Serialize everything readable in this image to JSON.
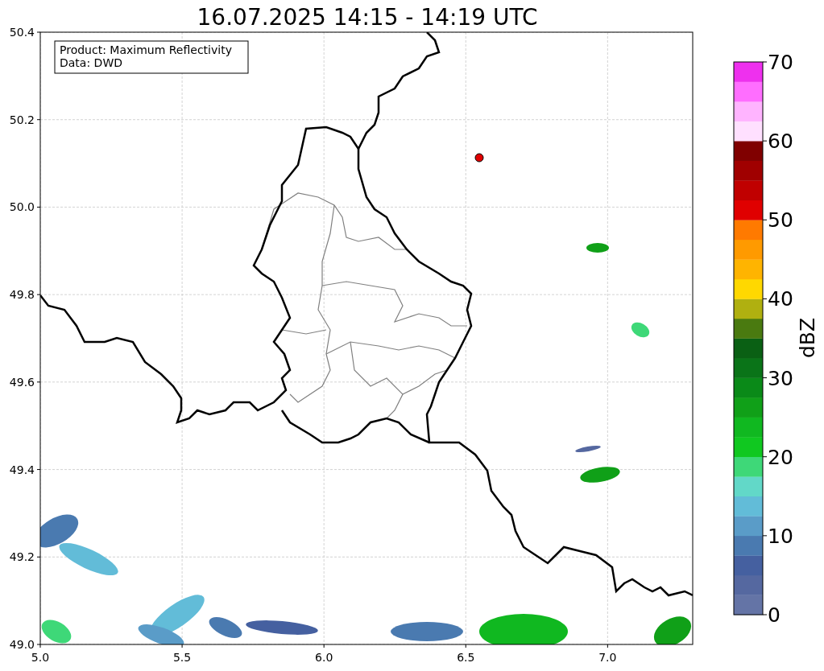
{
  "title": "16.07.2025 14:15 - 14:19 UTC",
  "annotation": [
    "Product: Maximum Reflectivity",
    "Data: DWD"
  ],
  "x_ticks": [
    "5.0",
    "5.5",
    "6.0",
    "6.5",
    "7.0"
  ],
  "y_ticks": [
    "50.4",
    "50.2",
    "50.0",
    "49.8",
    "49.6",
    "49.4",
    "49.2",
    "49.0"
  ],
  "colorbar": {
    "label": "dBZ",
    "ticks": [
      "70",
      "60",
      "50",
      "40",
      "30",
      "20",
      "10",
      "0"
    ],
    "segments": [
      {
        "color": "#6474a6"
      },
      {
        "color": "#5568a0"
      },
      {
        "color": "#4560a0"
      },
      {
        "color": "#4a7ab0"
      },
      {
        "color": "#5a9cc8"
      },
      {
        "color": "#62bcd8"
      },
      {
        "color": "#62d8c8"
      },
      {
        "color": "#3ed878"
      },
      {
        "color": "#10c820"
      },
      {
        "color": "#10b820"
      },
      {
        "color": "#10a018"
      },
      {
        "color": "#0a8a18"
      },
      {
        "color": "#0a7418"
      },
      {
        "color": "#0a6014"
      },
      {
        "color": "#4a7a10"
      },
      {
        "color": "#b0b010"
      },
      {
        "color": "#ffd800"
      },
      {
        "color": "#ffb400"
      },
      {
        "color": "#ff9a00"
      },
      {
        "color": "#ff7a00"
      },
      {
        "color": "#e00000"
      },
      {
        "color": "#c00000"
      },
      {
        "color": "#a00000"
      },
      {
        "color": "#800000"
      },
      {
        "color": "#ffe0ff"
      },
      {
        "color": "#ffb4ff"
      },
      {
        "color": "#ff6eff"
      },
      {
        "color": "#ee30ee"
      }
    ]
  }
}
